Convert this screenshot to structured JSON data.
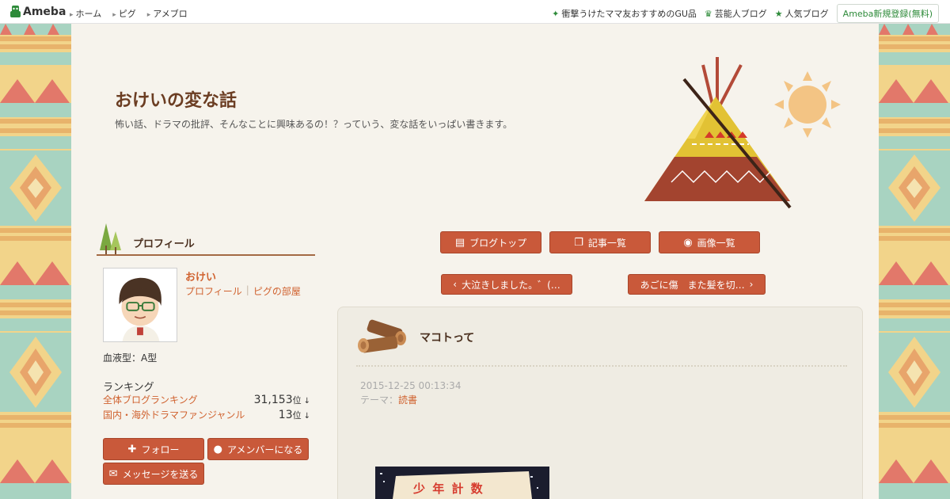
{
  "topbar": {
    "logo_text": "Ameba",
    "nav": [
      "ホーム",
      "ピグ",
      "アメブロ"
    ],
    "right_links": [
      {
        "label": "衝撃うけたママ友おすすめのGU品",
        "icon": "sparkle-icon"
      },
      {
        "label": "芸能人ブログ",
        "icon": "crown-icon"
      },
      {
        "label": "人気ブログ",
        "icon": "star-icon"
      }
    ],
    "register_label": "Ameba新規登録(無料)"
  },
  "header": {
    "title": "おけいの変な話",
    "description": "怖い話、ドラマの批評、そんなことに興味あるの！？っていう、変な話をいっぱい書きます。"
  },
  "nav_buttons": {
    "blog_top": "ブログトップ",
    "article_list": "記事一覧",
    "image_list": "画像一覧",
    "prev": "大泣きしました。゛(…",
    "next": "あごに傷　また髪を切…"
  },
  "profile": {
    "heading": "プロフィール",
    "name": "おけい",
    "links": [
      "プロフィール",
      "ピグの部屋"
    ],
    "blood_type": "血液型：A型",
    "ranking_title": "ランキング",
    "rankings": [
      {
        "name": "全体ブログランキング",
        "value": "31,153",
        "unit": "位",
        "trend": "↓"
      },
      {
        "name": "国内・海外ドラマファンジャンル",
        "value": "13",
        "unit": "位",
        "trend": "↓"
      }
    ],
    "follow_label": "フォロー",
    "amember_label": "アメンバーになる",
    "message_label": "メッセージを送る"
  },
  "entry": {
    "title": "マコトって",
    "date": "2015-12-25 00:13:34",
    "theme_label": "テーマ：",
    "theme": "読書",
    "photo_text": "少 年 計 数"
  },
  "colors": {
    "accent_button": "#c9593a",
    "link": "#d0622f",
    "title_brown": "#6b3d22",
    "ameba_green": "#2e8b3a"
  }
}
